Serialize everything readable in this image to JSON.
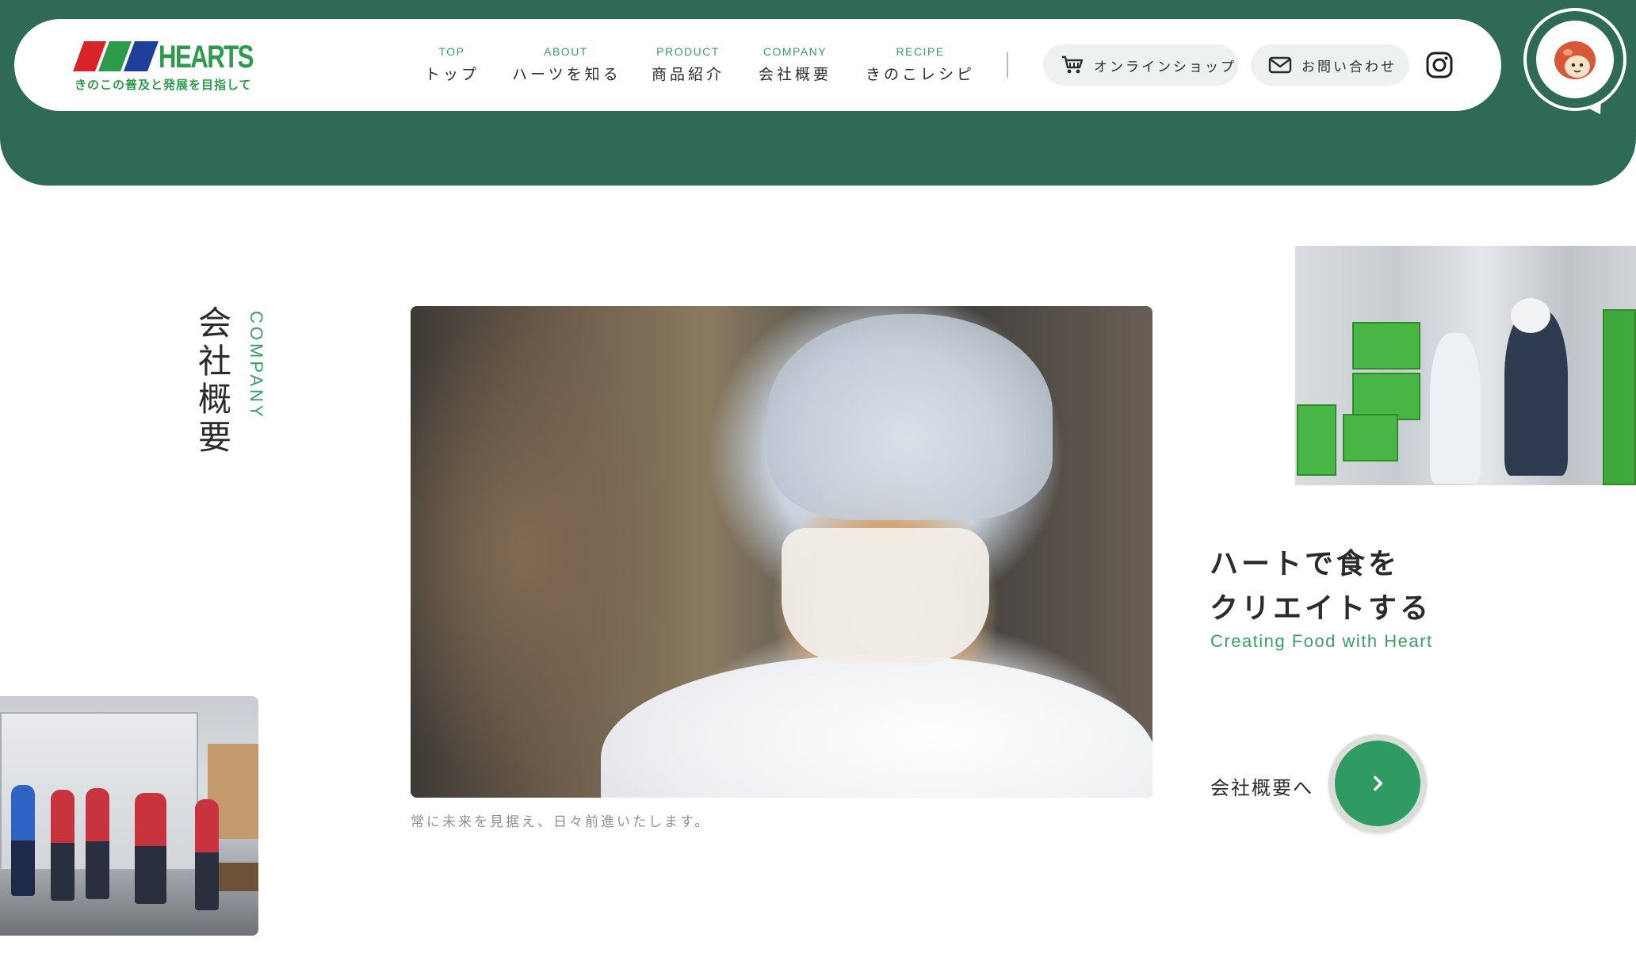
{
  "header": {
    "logo": {
      "word": "HEARTS",
      "tagline": "きのこの普及と発展を目指して",
      "stripe_colors": [
        "#d8232a",
        "#2e9a4b",
        "#1e3f9a"
      ]
    },
    "nav": [
      {
        "en": "TOP",
        "ja": "トップ"
      },
      {
        "en": "ABOUT",
        "ja": "ハーツを知る"
      },
      {
        "en": "PRODUCT",
        "ja": "商品紹介"
      },
      {
        "en": "COMPANY",
        "ja": "会社概要"
      },
      {
        "en": "RECIPE",
        "ja": "きのこレシピ"
      }
    ],
    "shop_button": {
      "label": "オンラインショップ",
      "icon": "cart-icon"
    },
    "contact_button": {
      "label": "お問い合わせ",
      "icon": "mail-icon"
    },
    "instagram_icon": "instagram-icon",
    "mascot_icon": "mushroom-mascot-icon"
  },
  "section": {
    "title_ja": "会社概要",
    "title_en": "COMPANY",
    "caption": "常に未来を見据え、日々前進いたします。",
    "headline": [
      "ハートで食を",
      "クリエイトする"
    ],
    "subline": "Creating Food with Heart",
    "more_label": "会社概要へ",
    "more_icon": "chevron-right-icon"
  },
  "colors": {
    "header_green": "#2f6a59",
    "accent_green": "#3a9f64",
    "button_green": "#2f9a62",
    "text": "#2b2b2b"
  }
}
